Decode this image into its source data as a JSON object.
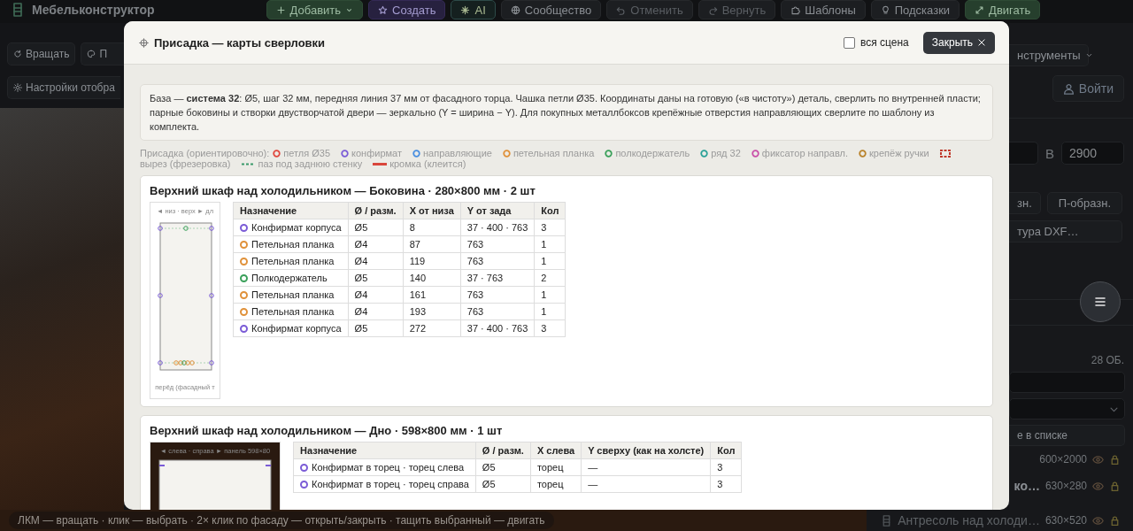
{
  "app": {
    "title": "Мебельконструктор"
  },
  "toolbar": [
    {
      "label": "Добавить",
      "kind": "primary",
      "caret": true,
      "disabled": false
    },
    {
      "label": "Создать",
      "kind": "create",
      "caret": false,
      "disabled": false
    },
    {
      "label": "AI",
      "kind": "ai",
      "caret": false,
      "disabled": false
    },
    {
      "label": "Сообщество",
      "kind": "normal",
      "caret": false,
      "disabled": false
    },
    {
      "label": "Отменить",
      "kind": "normal",
      "caret": false,
      "disabled": true
    },
    {
      "label": "Вернуть",
      "kind": "normal",
      "caret": false,
      "disabled": true
    },
    {
      "label": "Шаблоны",
      "kind": "normal",
      "caret": false,
      "disabled": false
    },
    {
      "label": "Подсказки",
      "kind": "normal",
      "caret": false,
      "disabled": false
    },
    {
      "label": "Двигать",
      "kind": "primary",
      "caret": false,
      "disabled": false
    }
  ],
  "left_panel": {
    "buttons": [
      "Вращать",
      "П"
    ],
    "settings": "Настройки отобра"
  },
  "right_panel": {
    "tools": "нструменты",
    "login": "Войти",
    "height_label": "В",
    "height_value": "2900",
    "shape_buttons": [
      "зн.",
      "П-образн."
    ],
    "dxf_button": "тура DXF…",
    "count": "28 ОБ.",
    "list_button": "е в списке",
    "objects": [
      {
        "size": "600×2000"
      },
      {
        "name": "ко…",
        "size": "630×280"
      },
      {
        "name": "Антресоль над холоди…",
        "size": "630×520"
      }
    ]
  },
  "hint": "ЛКМ — вращать · клик — выбрать · 2× клик по фасаду — открыть/закрыть · тащить выбранный — двигать",
  "modal": {
    "title": "Присадка — карты сверловки",
    "whole_scene": {
      "label": "вся сцена",
      "checked": false
    },
    "close": "Закрыть",
    "info": "База — **система 32**: Ø5, шаг 32 мм, передняя линия 37 мм от фасадного торца. Чашка петли Ø35. Координаты даны на готовую («в чистоту») деталь, сверлить по внутренней пласти; парные боковины и створки двустворчатой двери — зеркально (Y = ширина − Y). Для покупных металлбоксов крепёжные отверстия направляющих сверлите по шаблону из комплекта.",
    "legend": {
      "label": "Присадка (ориентировочно):",
      "items": [
        {
          "kind": "ring",
          "label": "петля Ø35",
          "color": "#e0483e"
        },
        {
          "kind": "ring",
          "label": "конфирмат",
          "color": "#7b5cd6"
        },
        {
          "kind": "ring",
          "label": "направляющие",
          "color": "#4a8fe0"
        },
        {
          "kind": "ring",
          "label": "петельная планка",
          "color": "#e0913a"
        },
        {
          "kind": "ring",
          "label": "полкодержатель",
          "color": "#3aa05a"
        },
        {
          "kind": "ring",
          "label": "ряд 32",
          "color": "#2aa198"
        },
        {
          "kind": "ring",
          "label": "фиксатор направл.",
          "color": "#c94fa8"
        },
        {
          "kind": "ring",
          "label": "крепёж ручки",
          "color": "#b9822a"
        },
        {
          "kind": "cutout",
          "label": "вырез (фрезеровка)",
          "color": "#c0392b"
        },
        {
          "kind": "groove",
          "label": "паз под заднюю стенку",
          "color": "#3a9a6a"
        },
        {
          "kind": "edge",
          "label": "кромка (клеится)",
          "color": "#d9463b"
        }
      ]
    },
    "parts": [
      {
        "title": "Верхний шкаф над холодильником — Боковина · 280×800 мм · 2 шт",
        "diagram": {
          "kind": "side",
          "top_caption": "◄ низ · верх ► дл",
          "bottom_caption": "перёд (фасадный т"
        },
        "columns": [
          "Назначение",
          "Ø / разм.",
          "X от низа",
          "Y от зада",
          "Кол"
        ],
        "rows": [
          {
            "color": "#7b5cd6",
            "cells": [
              "Конфирмат корпуса",
              "Ø5",
              "8",
              "37 · 400 · 763",
              "3"
            ]
          },
          {
            "color": "#e0913a",
            "cells": [
              "Петельная планка",
              "Ø4",
              "87",
              "763",
              "1"
            ]
          },
          {
            "color": "#e0913a",
            "cells": [
              "Петельная планка",
              "Ø4",
              "119",
              "763",
              "1"
            ]
          },
          {
            "color": "#3aa05a",
            "cells": [
              "Полкодержатель",
              "Ø5",
              "140",
              "37 · 763",
              "2"
            ]
          },
          {
            "color": "#e0913a",
            "cells": [
              "Петельная планка",
              "Ø4",
              "161",
              "763",
              "1"
            ]
          },
          {
            "color": "#e0913a",
            "cells": [
              "Петельная планка",
              "Ø4",
              "193",
              "763",
              "1"
            ]
          },
          {
            "color": "#7b5cd6",
            "cells": [
              "Конфирмат корпуса",
              "Ø5",
              "272",
              "37 · 400 · 763",
              "3"
            ]
          }
        ]
      },
      {
        "title": "Верхний шкаф над холодильником — Дно · 598×800 мм · 1 шт",
        "diagram": {
          "kind": "bottom",
          "top_caption": "◄ слева · справа ► панель 598×80"
        },
        "columns": [
          "Назначение",
          "Ø / разм.",
          "X слева",
          "Y сверху (как на холсте)",
          "Кол"
        ],
        "rows": [
          {
            "color": "#7b5cd6",
            "cells": [
              "Конфирмат в торец · торец слева",
              "Ø5",
              "торец",
              "—",
              "3"
            ]
          },
          {
            "color": "#7b5cd6",
            "cells": [
              "Конфирмат в торец · торец справа",
              "Ø5",
              "торец",
              "—",
              "3"
            ]
          }
        ]
      }
    ]
  }
}
